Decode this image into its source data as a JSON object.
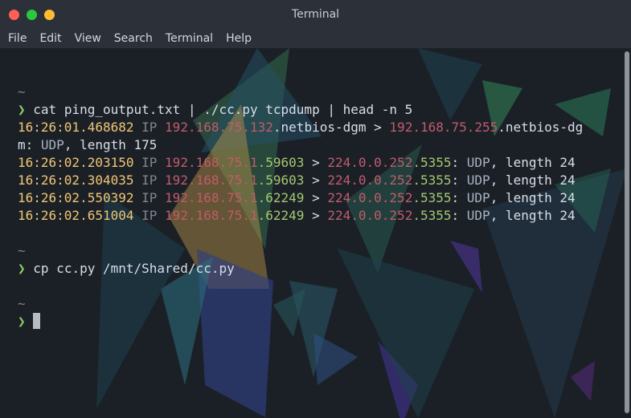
{
  "window": {
    "title": "Terminal",
    "controls": [
      "close",
      "minimize",
      "maximize"
    ]
  },
  "menu": [
    "File",
    "Edit",
    "View",
    "Search",
    "Terminal",
    "Help"
  ],
  "terminal": {
    "prompt_symbol": "❯",
    "home_symbol": "~",
    "command1": "cat ping_output.txt | ./cc.py tcpdump | head -n 5",
    "output": [
      {
        "time": "16:26:01.468682",
        "ip_label": "IP",
        "src_ip": "192.168.75.132",
        "src_port": ".netbios-dgm",
        "arrow": ">",
        "dst_ip": "192.168.75.255",
        "dst_port": ".netbios-dg",
        "wrap": "m:",
        "proto": "UDP",
        "length_label": ", length",
        "length": "175"
      },
      {
        "time": "16:26:02.203150",
        "ip_label": "IP",
        "src_ip": "192.168.75.1",
        "src_port": ".59603",
        "arrow": ">",
        "dst_ip": "224.0.0.252",
        "dst_port": ".5355",
        "colon": ":",
        "proto": "UDP",
        "length_label": ", length",
        "length": "24"
      },
      {
        "time": "16:26:02.304035",
        "ip_label": "IP",
        "src_ip": "192.168.75.1",
        "src_port": ".59603",
        "arrow": ">",
        "dst_ip": "224.0.0.252",
        "dst_port": ".5355",
        "colon": ":",
        "proto": "UDP",
        "length_label": ", length",
        "length": "24"
      },
      {
        "time": "16:26:02.550392",
        "ip_label": "IP",
        "src_ip": "192.168.75.1",
        "src_port": ".62249",
        "arrow": ">",
        "dst_ip": "224.0.0.252",
        "dst_port": ".5355",
        "colon": ":",
        "proto": "UDP",
        "length_label": ", length",
        "length": "24"
      },
      {
        "time": "16:26:02.651004",
        "ip_label": "IP",
        "src_ip": "192.168.75.1",
        "src_port": ".62249",
        "arrow": ">",
        "dst_ip": "224.0.0.252",
        "dst_port": ".5355",
        "colon": ":",
        "proto": "UDP",
        "length_label": ", length",
        "length": "24"
      }
    ],
    "command2": "cp cc.py /mnt/Shared/cc.py"
  },
  "colors": {
    "accent_green": "#8ccf62",
    "time_yellow": "#f0c674",
    "ip_red": "#c25b6b",
    "port_green": "#a3c86e"
  }
}
